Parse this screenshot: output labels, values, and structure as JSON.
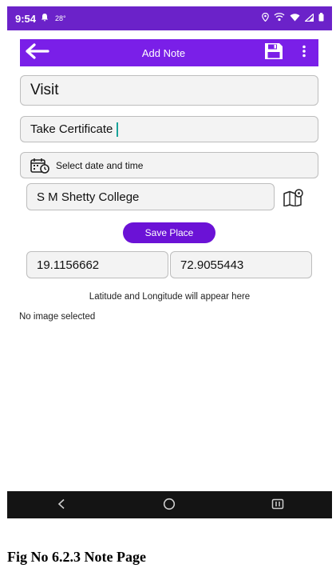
{
  "status_bar": {
    "time": "9:54",
    "temperature": "28°"
  },
  "app_bar": {
    "title": "Add Note",
    "back_icon": "arrow-left-icon",
    "save_icon": "floppy-disk-icon",
    "more_icon": "more-vertical-icon"
  },
  "form": {
    "title_value": "Visit",
    "description_value": "Take Certificate",
    "date_label": "Select date and time",
    "place_value": "S M Shetty College",
    "save_place_label": "Save Place",
    "latitude_value": "19.1156662",
    "longitude_value": "72.9055443",
    "latlng_hint": "Latitude and Longitude will appear here",
    "image_status": "No image selected"
  },
  "nav_bar": {
    "back": "<",
    "home": "○",
    "recents": "|||"
  },
  "caption": "Fig No 6.2.3  Note Page",
  "colors": {
    "status_bar": "#6b22c9",
    "app_bar": "#7a1fe8",
    "save_button": "#6b12d6",
    "nav_bar": "#141414",
    "cursor": "#1aa39a"
  }
}
